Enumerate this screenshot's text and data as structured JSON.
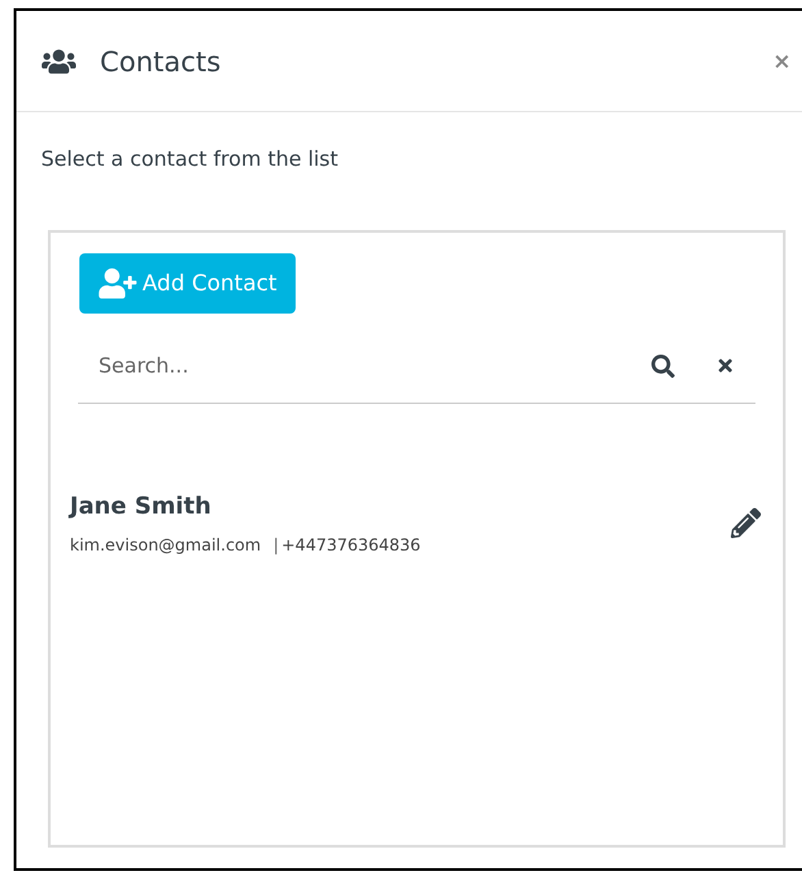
{
  "dialog": {
    "title": "Contacts",
    "close": "×"
  },
  "instruction": "Select a contact from the list",
  "add_button": "Add Contact",
  "search": {
    "placeholder": "Search..."
  },
  "contacts": [
    {
      "name": "Jane Smith",
      "email": "kim.evison@gmail.com",
      "separator": "|",
      "phone": "+447376364836"
    }
  ]
}
